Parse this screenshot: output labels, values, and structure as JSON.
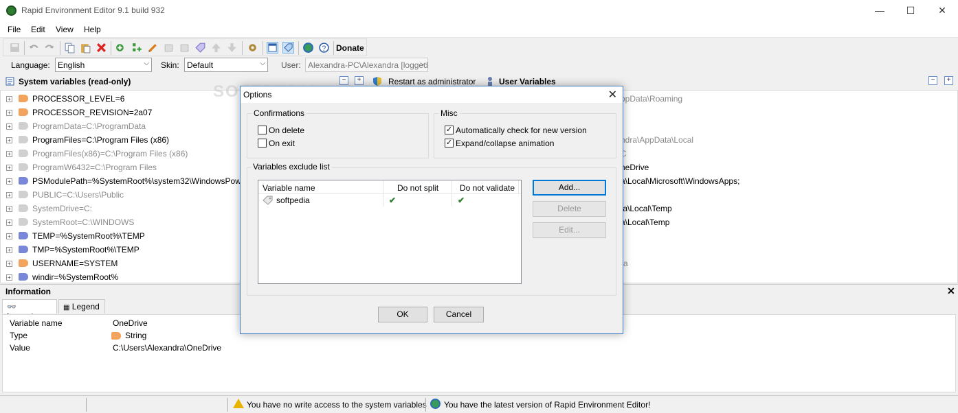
{
  "window": {
    "title": "Rapid Environment Editor 9.1 build 932",
    "minimize": "—",
    "maximize": "☐",
    "close": "✕"
  },
  "menu": [
    "File",
    "Edit",
    "View",
    "Help"
  ],
  "toolbar": {
    "donate_label": "Donate"
  },
  "options_bar": {
    "language_label": "Language:",
    "language_value": "English",
    "skin_label": "Skin:",
    "skin_value": "Default",
    "user_label": "User:",
    "user_value": "Alexandra-PC\\Alexandra [logged"
  },
  "system_panel": {
    "title": "System variables (read-only)",
    "restart_label": "Restart as administrator",
    "variables": [
      {
        "text": "PROCESSOR_LEVEL=6",
        "tag": "orange",
        "dim": false
      },
      {
        "text": "PROCESSOR_REVISION=2a07",
        "tag": "orange",
        "dim": false
      },
      {
        "text": "ProgramData=C:\\ProgramData",
        "tag": "grey",
        "dim": true
      },
      {
        "text": "ProgramFiles=C:\\Program Files (x86)",
        "tag": "grey",
        "dim": false
      },
      {
        "text": "ProgramFiles(x86)=C:\\Program Files (x86)",
        "tag": "grey",
        "dim": true
      },
      {
        "text": "ProgramW6432=C:\\Program Files",
        "tag": "grey",
        "dim": true
      },
      {
        "text": "PSModulePath=%SystemRoot%\\system32\\WindowsPowerShel",
        "tag": "blue",
        "dim": false
      },
      {
        "text": "PUBLIC=C:\\Users\\Public",
        "tag": "grey",
        "dim": true
      },
      {
        "text": "SystemDrive=C:",
        "tag": "grey",
        "dim": true
      },
      {
        "text": "SystemRoot=C:\\WINDOWS",
        "tag": "grey",
        "dim": true
      },
      {
        "text": "TEMP=%SystemRoot%\\TEMP",
        "tag": "blue",
        "dim": false
      },
      {
        "text": "TMP=%SystemRoot%\\TEMP",
        "tag": "blue",
        "dim": false
      },
      {
        "text": "USERNAME=SYSTEM",
        "tag": "orange",
        "dim": false
      },
      {
        "text": "windir=%SystemRoot%",
        "tag": "blue",
        "dim": false
      }
    ]
  },
  "user_panel": {
    "title": "User Variables",
    "visible_fragments": [
      {
        "text": "ppData\\Roaming",
        "dim": true
      },
      {
        "text": "ndra\\AppData\\Local",
        "dim": true
      },
      {
        "text": "C",
        "dim": true
      },
      {
        "text": "neDrive",
        "dim": false
      },
      {
        "text": "a\\Local\\Microsoft\\WindowsApps;",
        "dim": false
      },
      {
        "text": "ta\\Local\\Temp",
        "dim": false
      },
      {
        "text": "a\\Local\\Temp",
        "dim": false
      },
      {
        "text": "ra",
        "dim": true
      }
    ]
  },
  "information": {
    "title": "Information",
    "tabs": [
      "Inspector",
      "Legend"
    ],
    "rows": [
      {
        "key": "Variable name",
        "value": "OneDrive"
      },
      {
        "key": "Type",
        "value": "String"
      },
      {
        "key": "Value",
        "value": "C:\\Users\\Alexandra\\OneDrive"
      }
    ]
  },
  "status": {
    "write_access": "You have no write access to the system variables",
    "version": "You have the latest version of Rapid Environment Editor!"
  },
  "dialog": {
    "title": "Options",
    "confirmations": {
      "label": "Confirmations",
      "on_delete": {
        "label": "On delete",
        "checked": false
      },
      "on_exit": {
        "label": "On exit",
        "checked": false
      }
    },
    "misc": {
      "label": "Misc",
      "auto_check": {
        "label": "Automatically check for new version",
        "checked": true
      },
      "expand_anim": {
        "label": "Expand/collapse animation",
        "checked": true
      }
    },
    "exclude_list": {
      "label": "Variables exclude list",
      "columns": [
        "Variable name",
        "Do not split",
        "Do not validate"
      ],
      "rows": [
        {
          "name": "softpedia",
          "no_split": true,
          "no_validate": true
        }
      ]
    },
    "buttons": {
      "add": "Add...",
      "delete": "Delete",
      "edit": "Edit...",
      "ok": "OK",
      "cancel": "Cancel"
    }
  },
  "watermark": "SOFTPEDIA"
}
